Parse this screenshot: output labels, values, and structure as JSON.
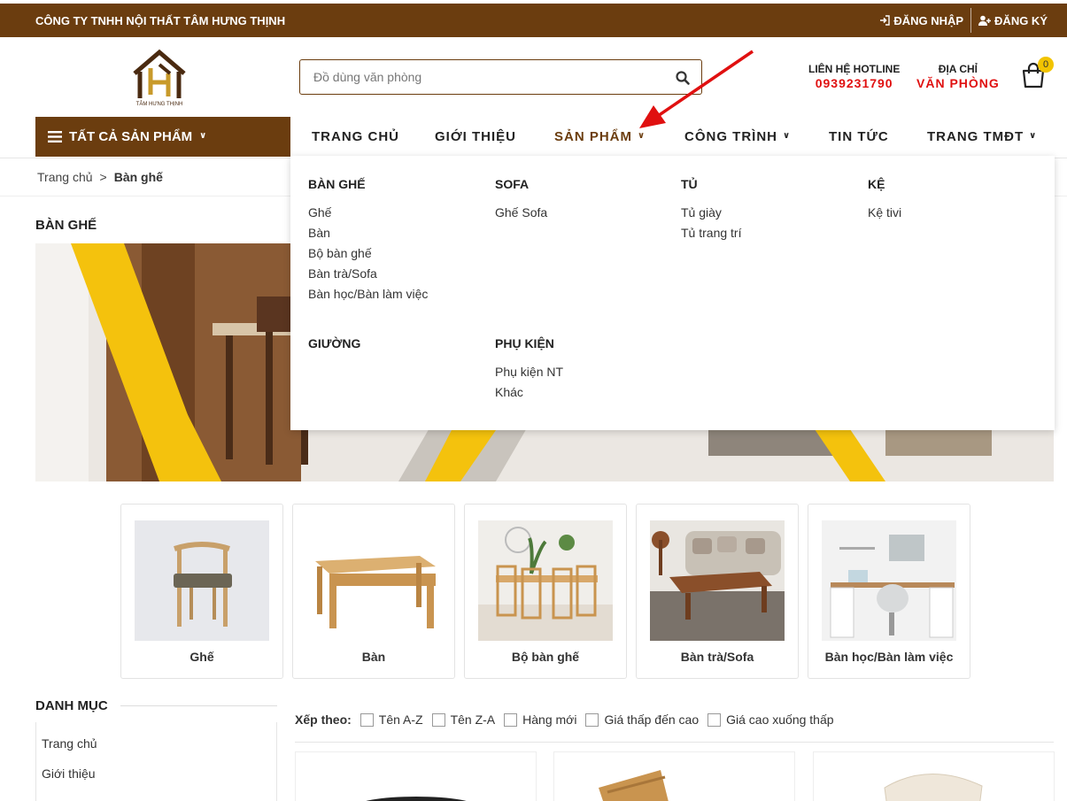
{
  "topbar": {
    "company": "CÔNG TY TNHH NỘI THẤT TÂM HƯNG THỊNH",
    "login": "ĐĂNG NHẬP",
    "register": "ĐĂNG KÝ"
  },
  "header": {
    "logo_text": "TÂM HƯNG THỊNH",
    "search_placeholder": "Đồ dùng văn phòng",
    "hotline_label": "LIÊN HỆ HOTLINE",
    "hotline_number": "0939231790",
    "address_label": "ĐỊA CHỈ",
    "address_value": "VĂN PHÒNG",
    "cart_count": "0"
  },
  "nav": {
    "all_categories": "TẤT CẢ SẢN PHẨM",
    "items": [
      {
        "label": "TRANG CHỦ"
      },
      {
        "label": "GIỚI THIỆU"
      },
      {
        "label": "SẢN PHẨM"
      },
      {
        "label": "CÔNG TRÌNH"
      },
      {
        "label": "TIN TỨC"
      },
      {
        "label": "TRANG TMĐT"
      }
    ]
  },
  "breadcrumb": {
    "home": "Trang chủ",
    "sep": ">",
    "current": "Bàn ghế"
  },
  "section_title": "BÀN GHẾ",
  "dropdown": {
    "groups": [
      {
        "title": "BÀN GHẾ",
        "links": [
          "Ghế",
          "Bàn",
          "Bộ bàn ghế",
          "Bàn trà/Sofa",
          "Bàn học/Bàn làm việc"
        ]
      },
      {
        "title": "SOFA",
        "links": [
          "Ghế Sofa"
        ]
      },
      {
        "title": "TỦ",
        "links": [
          "Tủ giày",
          "Tủ trang trí"
        ]
      },
      {
        "title": "KỆ",
        "links": [
          "Kệ tivi"
        ]
      },
      {
        "title": "GIƯỜNG",
        "links": []
      },
      {
        "title": "PHỤ KIỆN",
        "links": [
          "Phụ kiện NT",
          "Khác"
        ]
      }
    ]
  },
  "categories": [
    {
      "label": "Ghế"
    },
    {
      "label": "Bàn"
    },
    {
      "label": "Bộ bàn ghế"
    },
    {
      "label": "Bàn trà/Sofa"
    },
    {
      "label": "Bàn học/Bàn làm việc"
    }
  ],
  "sidebar": {
    "title": "DANH MỤC",
    "items": [
      "Trang chủ",
      "Giới thiệu"
    ]
  },
  "sort": {
    "label": "Xếp theo:",
    "options": [
      "Tên A-Z",
      "Tên Z-A",
      "Hàng mới",
      "Giá thấp đến cao",
      "Giá cao xuống thấp"
    ]
  },
  "colors": {
    "brand": "#6b3d0f",
    "hotline": "#e01010",
    "badge": "#f2c400"
  }
}
